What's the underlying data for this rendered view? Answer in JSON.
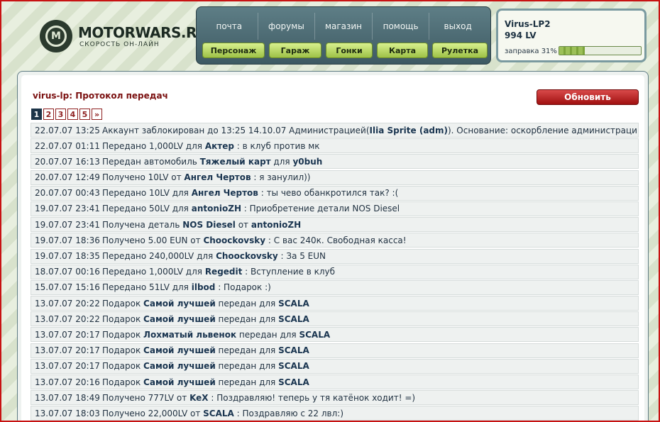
{
  "brand": {
    "title": "MOTORWARS.RU",
    "subtitle": "СКОРОСТЬ ОН-ЛАЙН",
    "logo_letter": "M"
  },
  "top_nav": [
    "почта",
    "форумы",
    "магазин",
    "помощь",
    "выход"
  ],
  "sub_nav": [
    "Персонаж",
    "Гараж",
    "Гонки",
    "Карта",
    "Рулетка"
  ],
  "user": {
    "name": "Virus-LP2",
    "balance": "994 LV",
    "fuel_label": "заправка 31%",
    "fuel_percent": 31
  },
  "page": {
    "title": "virus-lp: Протокол передач",
    "refresh_label": "Обновить"
  },
  "pagination": {
    "pages": [
      "1",
      "2",
      "3",
      "4",
      "5",
      "»"
    ],
    "current": "1"
  },
  "log": [
    {
      "date": "22.07.07 13:25",
      "parts": [
        [
          "Аккаунт заблокирован до 13:25 14.10.07 Администрацией(",
          false
        ],
        [
          "Ilia Sprite (adm)",
          true
        ],
        [
          "). Основание: оскорбление администрации в фотоальбоме.",
          false
        ]
      ]
    },
    {
      "date": "22.07.07 01:11",
      "parts": [
        [
          "Передано 1,000LV для ",
          false
        ],
        [
          "Актер",
          true
        ],
        [
          " : в клуб против мк",
          false
        ]
      ]
    },
    {
      "date": "20.07.07 16:13",
      "parts": [
        [
          "Передан автомобиль ",
          false
        ],
        [
          "Тяжелый карт",
          true
        ],
        [
          " для ",
          false
        ],
        [
          "y0buh",
          true
        ]
      ]
    },
    {
      "date": "20.07.07 12:49",
      "parts": [
        [
          "Получено 10LV от ",
          false
        ],
        [
          "Ангел Чертов",
          true
        ],
        [
          " : я занулил))",
          false
        ]
      ]
    },
    {
      "date": "20.07.07 00:43",
      "parts": [
        [
          "Передано 10LV для ",
          false
        ],
        [
          "Ангел Чертов",
          true
        ],
        [
          " : ты чево обанкротился так? :(",
          false
        ]
      ]
    },
    {
      "date": "19.07.07 23:41",
      "parts": [
        [
          "Передано 50LV для ",
          false
        ],
        [
          "antonioZH",
          true
        ],
        [
          " : Приобретение детали NOS Diesel",
          false
        ]
      ]
    },
    {
      "date": "19.07.07 23:41",
      "parts": [
        [
          "Получена деталь ",
          false
        ],
        [
          "NOS Diesel",
          true
        ],
        [
          " от ",
          false
        ],
        [
          "antonioZH",
          true
        ]
      ]
    },
    {
      "date": "19.07.07 18:36",
      "parts": [
        [
          "Получено 5.00 EUN от ",
          false
        ],
        [
          "Choockovsky",
          true
        ],
        [
          " : С вас 240к. Свободная касса!",
          false
        ]
      ]
    },
    {
      "date": "19.07.07 18:35",
      "parts": [
        [
          "Передано 240,000LV для ",
          false
        ],
        [
          "Choockovsky",
          true
        ],
        [
          " : За 5 EUN",
          false
        ]
      ]
    },
    {
      "date": "18.07.07 00:16",
      "parts": [
        [
          "Передано 1,000LV для ",
          false
        ],
        [
          "Regedit",
          true
        ],
        [
          " : Вступление в клуб",
          false
        ]
      ]
    },
    {
      "date": "15.07.07 15:16",
      "parts": [
        [
          "Передано 51LV для ",
          false
        ],
        [
          "ilbod",
          true
        ],
        [
          " : Подарок :)",
          false
        ]
      ]
    },
    {
      "date": "13.07.07 20:22",
      "parts": [
        [
          "Подарок ",
          false
        ],
        [
          "Самой лучшей",
          true
        ],
        [
          " передан для ",
          false
        ],
        [
          "SCALA",
          true
        ]
      ]
    },
    {
      "date": "13.07.07 20:22",
      "parts": [
        [
          "Подарок ",
          false
        ],
        [
          "Самой лучшей",
          true
        ],
        [
          " передан для ",
          false
        ],
        [
          "SCALA",
          true
        ]
      ]
    },
    {
      "date": "13.07.07 20:17",
      "parts": [
        [
          "Подарок ",
          false
        ],
        [
          "Лохматый львенок",
          true
        ],
        [
          " передан для ",
          false
        ],
        [
          "SCALA",
          true
        ]
      ]
    },
    {
      "date": "13.07.07 20:17",
      "parts": [
        [
          "Подарок ",
          false
        ],
        [
          "Самой лучшей",
          true
        ],
        [
          " передан для ",
          false
        ],
        [
          "SCALA",
          true
        ]
      ]
    },
    {
      "date": "13.07.07 20:17",
      "parts": [
        [
          "Подарок ",
          false
        ],
        [
          "Самой лучшей",
          true
        ],
        [
          " передан для ",
          false
        ],
        [
          "SCALA",
          true
        ]
      ]
    },
    {
      "date": "13.07.07 20:16",
      "parts": [
        [
          "Подарок ",
          false
        ],
        [
          "Самой лучшей",
          true
        ],
        [
          " передан для ",
          false
        ],
        [
          "SCALA",
          true
        ]
      ]
    },
    {
      "date": "13.07.07 18:49",
      "parts": [
        [
          "Получено 777LV от ",
          false
        ],
        [
          "KeX",
          true
        ],
        [
          " : Поздравляю! теперь у тя катёнок ходит! =)",
          false
        ]
      ]
    },
    {
      "date": "13.07.07 18:03",
      "parts": [
        [
          "Получено 22,000LV от ",
          false
        ],
        [
          "SCALA",
          true
        ],
        [
          " : Поздравляю с 22 лвл:)",
          false
        ]
      ]
    }
  ]
}
